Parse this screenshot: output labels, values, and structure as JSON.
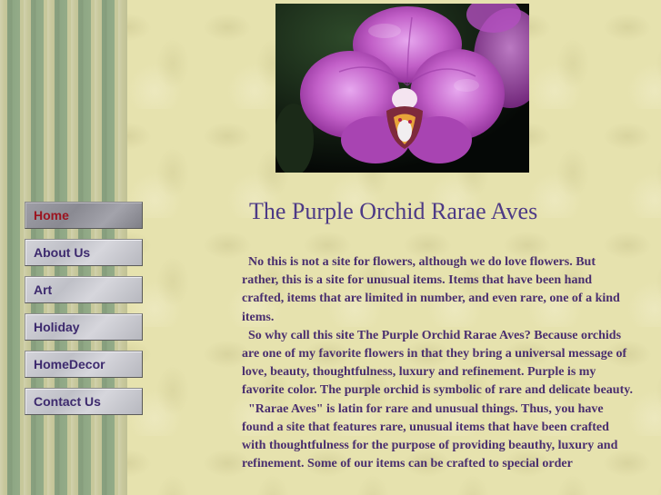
{
  "colors": {
    "background": "#e6e2ae",
    "title": "#4d3a86",
    "body_text": "#4a2f6f",
    "nav_text": "#3d2a6e",
    "nav_active_text": "#9c1420"
  },
  "hero": {
    "icon": "purple-orchid-photo"
  },
  "nav": {
    "items": [
      {
        "label": "Home",
        "active": true
      },
      {
        "label": "About Us",
        "active": false
      },
      {
        "label": "Art",
        "active": false
      },
      {
        "label": "Holiday",
        "active": false
      },
      {
        "label": "HomeDecor",
        "active": false
      },
      {
        "label": "Contact Us",
        "active": false
      }
    ]
  },
  "page": {
    "title": "The Purple Orchid Rarae Aves",
    "paragraphs": [
      "No this is not a site for flowers, although we do love flowers.  But rather, this is a site for unusual items.  Items that have been hand crafted, items that are limited in number, and even rare, one of a kind items.",
      "So why call this site The Purple Orchid Rarae Aves?  Because orchids are one of my favorite flowers in that they bring a universal message of love, beauty, thoughtfulness, luxury and refinement.  Purple is my favorite color.  The purple orchid is symbolic of rare and delicate beauty.",
      "\"Rarae Aves\" is latin for rare and unusual things.  Thus, you have found a site that features rare, unusual items that have been crafted with thoughtfulness for the purpose of providing beauthy, luxury and refinement.  Some of our items can be crafted to special order"
    ]
  }
}
